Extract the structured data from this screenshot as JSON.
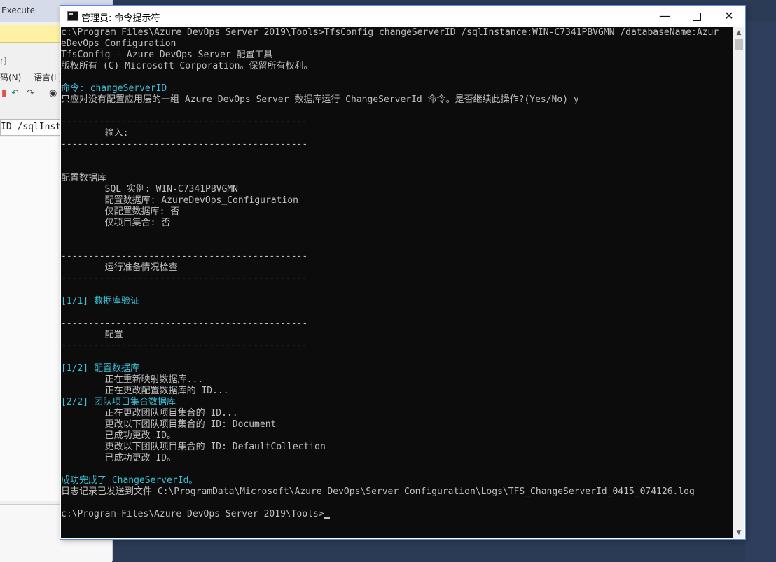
{
  "background_app": {
    "execute_label": "Execute",
    "bracket_text": "r]",
    "menu": [
      "码(N)",
      "语言(L)"
    ],
    "query_snippet": "ID /sqlInsta"
  },
  "window": {
    "title": "管理员: 命令提示符",
    "minimize_glyph": "—",
    "close_glyph": "✕"
  },
  "console": {
    "lines": [
      {
        "text": "c:\\Program Files\\Azure DevOps Server 2019\\Tools>TfsConfig changeServerID /sqlInstance:WIN-C7341PBVGMN /databaseName:Azur",
        "color": "gray"
      },
      {
        "text": "eDevOps_Configuration",
        "color": "gray"
      },
      {
        "text": "TfsConfig - Azure DevOps Server 配置工具",
        "color": "gray"
      },
      {
        "text": "版权所有 (C) Microsoft Corporation。保留所有权利。",
        "color": "gray"
      },
      {
        "text": "",
        "color": "gray"
      },
      {
        "text": "命令: changeServerID",
        "color": "cyan"
      },
      {
        "text": "只应对没有配置应用层的一组 Azure DevOps Server 数据库运行 ChangeServerId 命令。是否继续此操作?(Yes/No) y",
        "color": "gray"
      },
      {
        "text": "",
        "color": "gray"
      },
      {
        "text": "---------------------------------------------",
        "color": "gray"
      },
      {
        "text": "        输入:",
        "color": "gray"
      },
      {
        "text": "---------------------------------------------",
        "color": "gray"
      },
      {
        "text": "",
        "color": "gray"
      },
      {
        "text": "",
        "color": "gray"
      },
      {
        "text": "配置数据库",
        "color": "gray"
      },
      {
        "text": "        SQL 实例: WIN-C7341PBVGMN",
        "color": "gray"
      },
      {
        "text": "        配置数据库: AzureDevOps_Configuration",
        "color": "gray"
      },
      {
        "text": "        仅配置数据库: 否",
        "color": "gray"
      },
      {
        "text": "        仅项目集合: 否",
        "color": "gray"
      },
      {
        "text": "",
        "color": "gray"
      },
      {
        "text": "",
        "color": "gray"
      },
      {
        "text": "---------------------------------------------",
        "color": "gray"
      },
      {
        "text": "        运行准备情况检查",
        "color": "gray"
      },
      {
        "text": "---------------------------------------------",
        "color": "gray"
      },
      {
        "text": "",
        "color": "gray"
      },
      {
        "text": "[1/1] 数据库验证",
        "color": "cyan"
      },
      {
        "text": "",
        "color": "gray"
      },
      {
        "text": "---------------------------------------------",
        "color": "gray"
      },
      {
        "text": "        配置",
        "color": "gray"
      },
      {
        "text": "---------------------------------------------",
        "color": "gray"
      },
      {
        "text": "",
        "color": "gray"
      },
      {
        "text": "[1/2] 配置数据库",
        "color": "cyan"
      },
      {
        "text": "        正在重新映射数据库...",
        "color": "gray"
      },
      {
        "text": "        正在更改配置数据库的 ID...",
        "color": "gray"
      },
      {
        "text": "[2/2] 团队项目集合数据库",
        "color": "cyan"
      },
      {
        "text": "        正在更改团队项目集合的 ID...",
        "color": "gray"
      },
      {
        "text": "        更改以下团队项目集合的 ID: Document",
        "color": "gray"
      },
      {
        "text": "        已成功更改 ID。",
        "color": "gray"
      },
      {
        "text": "        更改以下团队项目集合的 ID: DefaultCollection",
        "color": "gray"
      },
      {
        "text": "        已成功更改 ID。",
        "color": "gray"
      },
      {
        "text": "",
        "color": "gray"
      },
      {
        "text": "成功完成了 ChangeServerId。",
        "color": "cyan"
      },
      {
        "text": "日志记录已发送到文件 C:\\ProgramData\\Microsoft\\Azure DevOps\\Server Configuration\\Logs\\TFS_ChangeServerId_0415_074126.log",
        "color": "gray"
      },
      {
        "text": "",
        "color": "gray"
      }
    ],
    "prompt": "c:\\Program Files\\Azure DevOps Server 2019\\Tools>"
  },
  "colors": {
    "console_bg": "#0c0c0c",
    "console_text": "#c0c0c0",
    "console_cyan": "#3cc0d8"
  }
}
